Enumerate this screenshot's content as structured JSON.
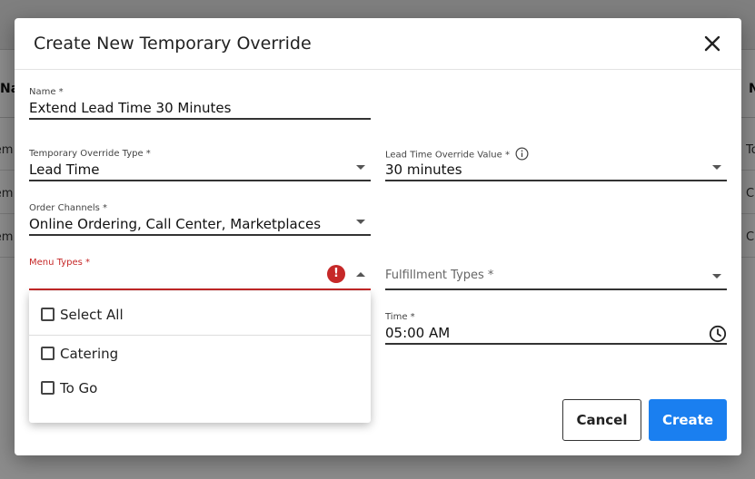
{
  "background": {
    "left_header_partial": "Na",
    "right_header_partial": "N",
    "left_rows_partial": [
      "Tem",
      "Tem",
      "Tem"
    ],
    "right_rows_partial": [
      "To",
      "C",
      "C"
    ]
  },
  "dialog": {
    "title": "Create New Temporary Override",
    "close_icon": "close-icon",
    "fields": {
      "name": {
        "label": "Name *",
        "value": "Extend Lead Time 30 Minutes"
      },
      "override_type": {
        "label": "Temporary Override Type *",
        "value": "Lead Time"
      },
      "lead_time_value": {
        "label": "Lead Time Override Value *",
        "value": "30 minutes",
        "icon": "info-icon"
      },
      "order_channels": {
        "label": "Order Channels *",
        "value": "Online Ordering, Call Center, Marketplaces"
      },
      "menu_types": {
        "label": "Menu Types *",
        "value": "",
        "error_icon": "!"
      },
      "fulfillment_types": {
        "label": "Fulfillment Types *",
        "value": ""
      },
      "time": {
        "label": "Time *",
        "value": "05:00 AM",
        "icon": "clock-icon"
      }
    },
    "menu_types_dropdown": {
      "select_all_label": "Select All",
      "options": [
        {
          "label": "Catering",
          "checked": false
        },
        {
          "label": "To Go",
          "checked": false
        }
      ]
    },
    "buttons": {
      "cancel_label": "Cancel",
      "create_label": "Create"
    }
  },
  "colors": {
    "primary": "#1a7ff0",
    "error": "#c62828",
    "overlay": "rgba(0,0,0,0.45)"
  }
}
